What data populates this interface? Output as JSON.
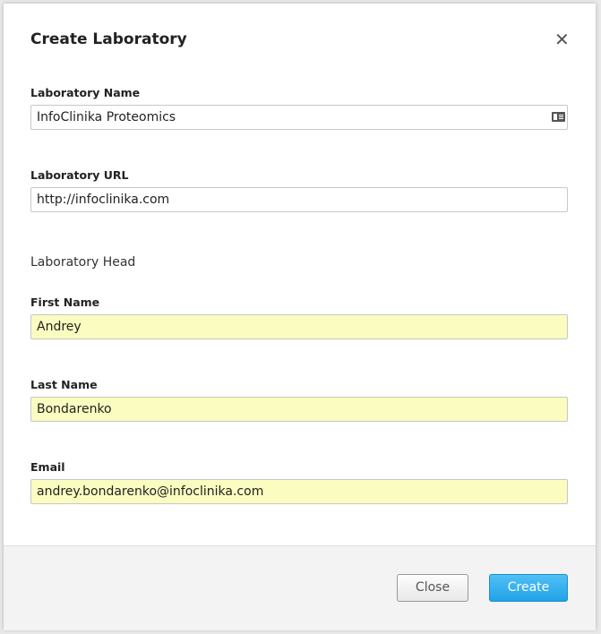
{
  "dialog": {
    "title": "Create Laboratory",
    "close_icon": "close-icon"
  },
  "fields": {
    "lab_name": {
      "label": "Laboratory Name",
      "value": "InfoClinika Proteomics",
      "icon": "contact-card-icon"
    },
    "lab_url": {
      "label": "Laboratory URL",
      "value": "http://infoclinika.com"
    },
    "head_section": "Laboratory Head",
    "first_name": {
      "label": "First Name",
      "value": "Andrey"
    },
    "last_name": {
      "label": "Last Name",
      "value": "Bondarenko"
    },
    "email": {
      "label": "Email",
      "value": "andrey.bondarenko@infoclinika.com"
    }
  },
  "footer": {
    "close_label": "Close",
    "create_label": "Create"
  },
  "colors": {
    "autofill": "#fafcc0",
    "primary": "#2aa8ec"
  }
}
